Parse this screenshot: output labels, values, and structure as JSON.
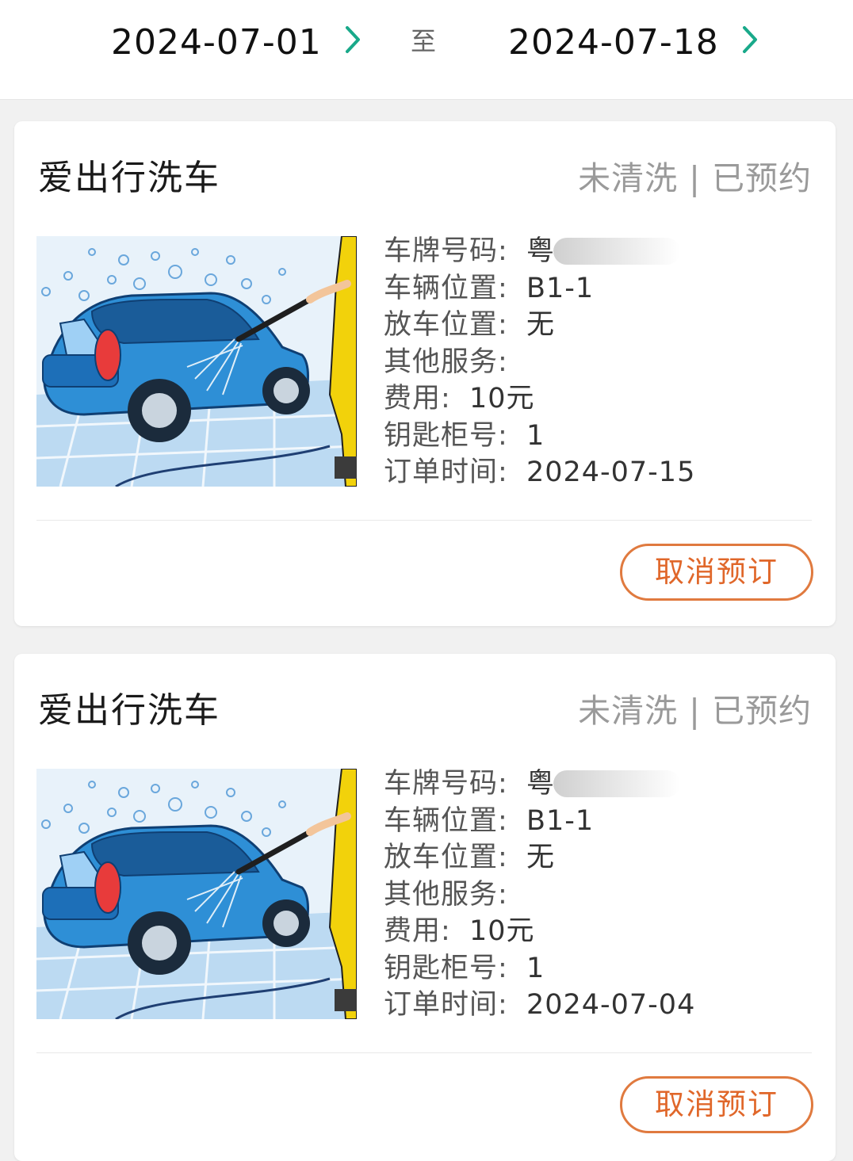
{
  "date_range": {
    "start": "2024-07-01",
    "separator": "至",
    "end": "2024-07-18"
  },
  "icons": {
    "date_next": "chevron-right-icon",
    "thumbnail": "car-wash-illustration"
  },
  "colors": {
    "accent_green": "#19a98a",
    "cancel_orange": "#e0672a",
    "status_gray": "#9a9a9a"
  },
  "orders": [
    {
      "shop_name": "爱出行洗车",
      "status": "未清洗 | 已预约",
      "labels": {
        "plate": "车牌号码:",
        "vehicle_location": "车辆位置:",
        "drop_location": "放车位置:",
        "other_services": "其他服务:",
        "fee": "费用:",
        "key_locker": "钥匙柜号:",
        "order_time": "订单时间:"
      },
      "plate": "粤",
      "vehicle_location": "B1-1",
      "drop_location": "无",
      "other_services": "",
      "fee": "10元",
      "key_locker": "1",
      "order_time": "2024-07-15",
      "cancel_label": "取消预订"
    },
    {
      "shop_name": "爱出行洗车",
      "status": "未清洗 | 已预约",
      "labels": {
        "plate": "车牌号码:",
        "vehicle_location": "车辆位置:",
        "drop_location": "放车位置:",
        "other_services": "其他服务:",
        "fee": "费用:",
        "key_locker": "钥匙柜号:",
        "order_time": "订单时间:"
      },
      "plate": "粤",
      "vehicle_location": "B1-1",
      "drop_location": "无",
      "other_services": "",
      "fee": "10元",
      "key_locker": "1",
      "order_time": "2024-07-04",
      "cancel_label": "取消预订"
    }
  ]
}
